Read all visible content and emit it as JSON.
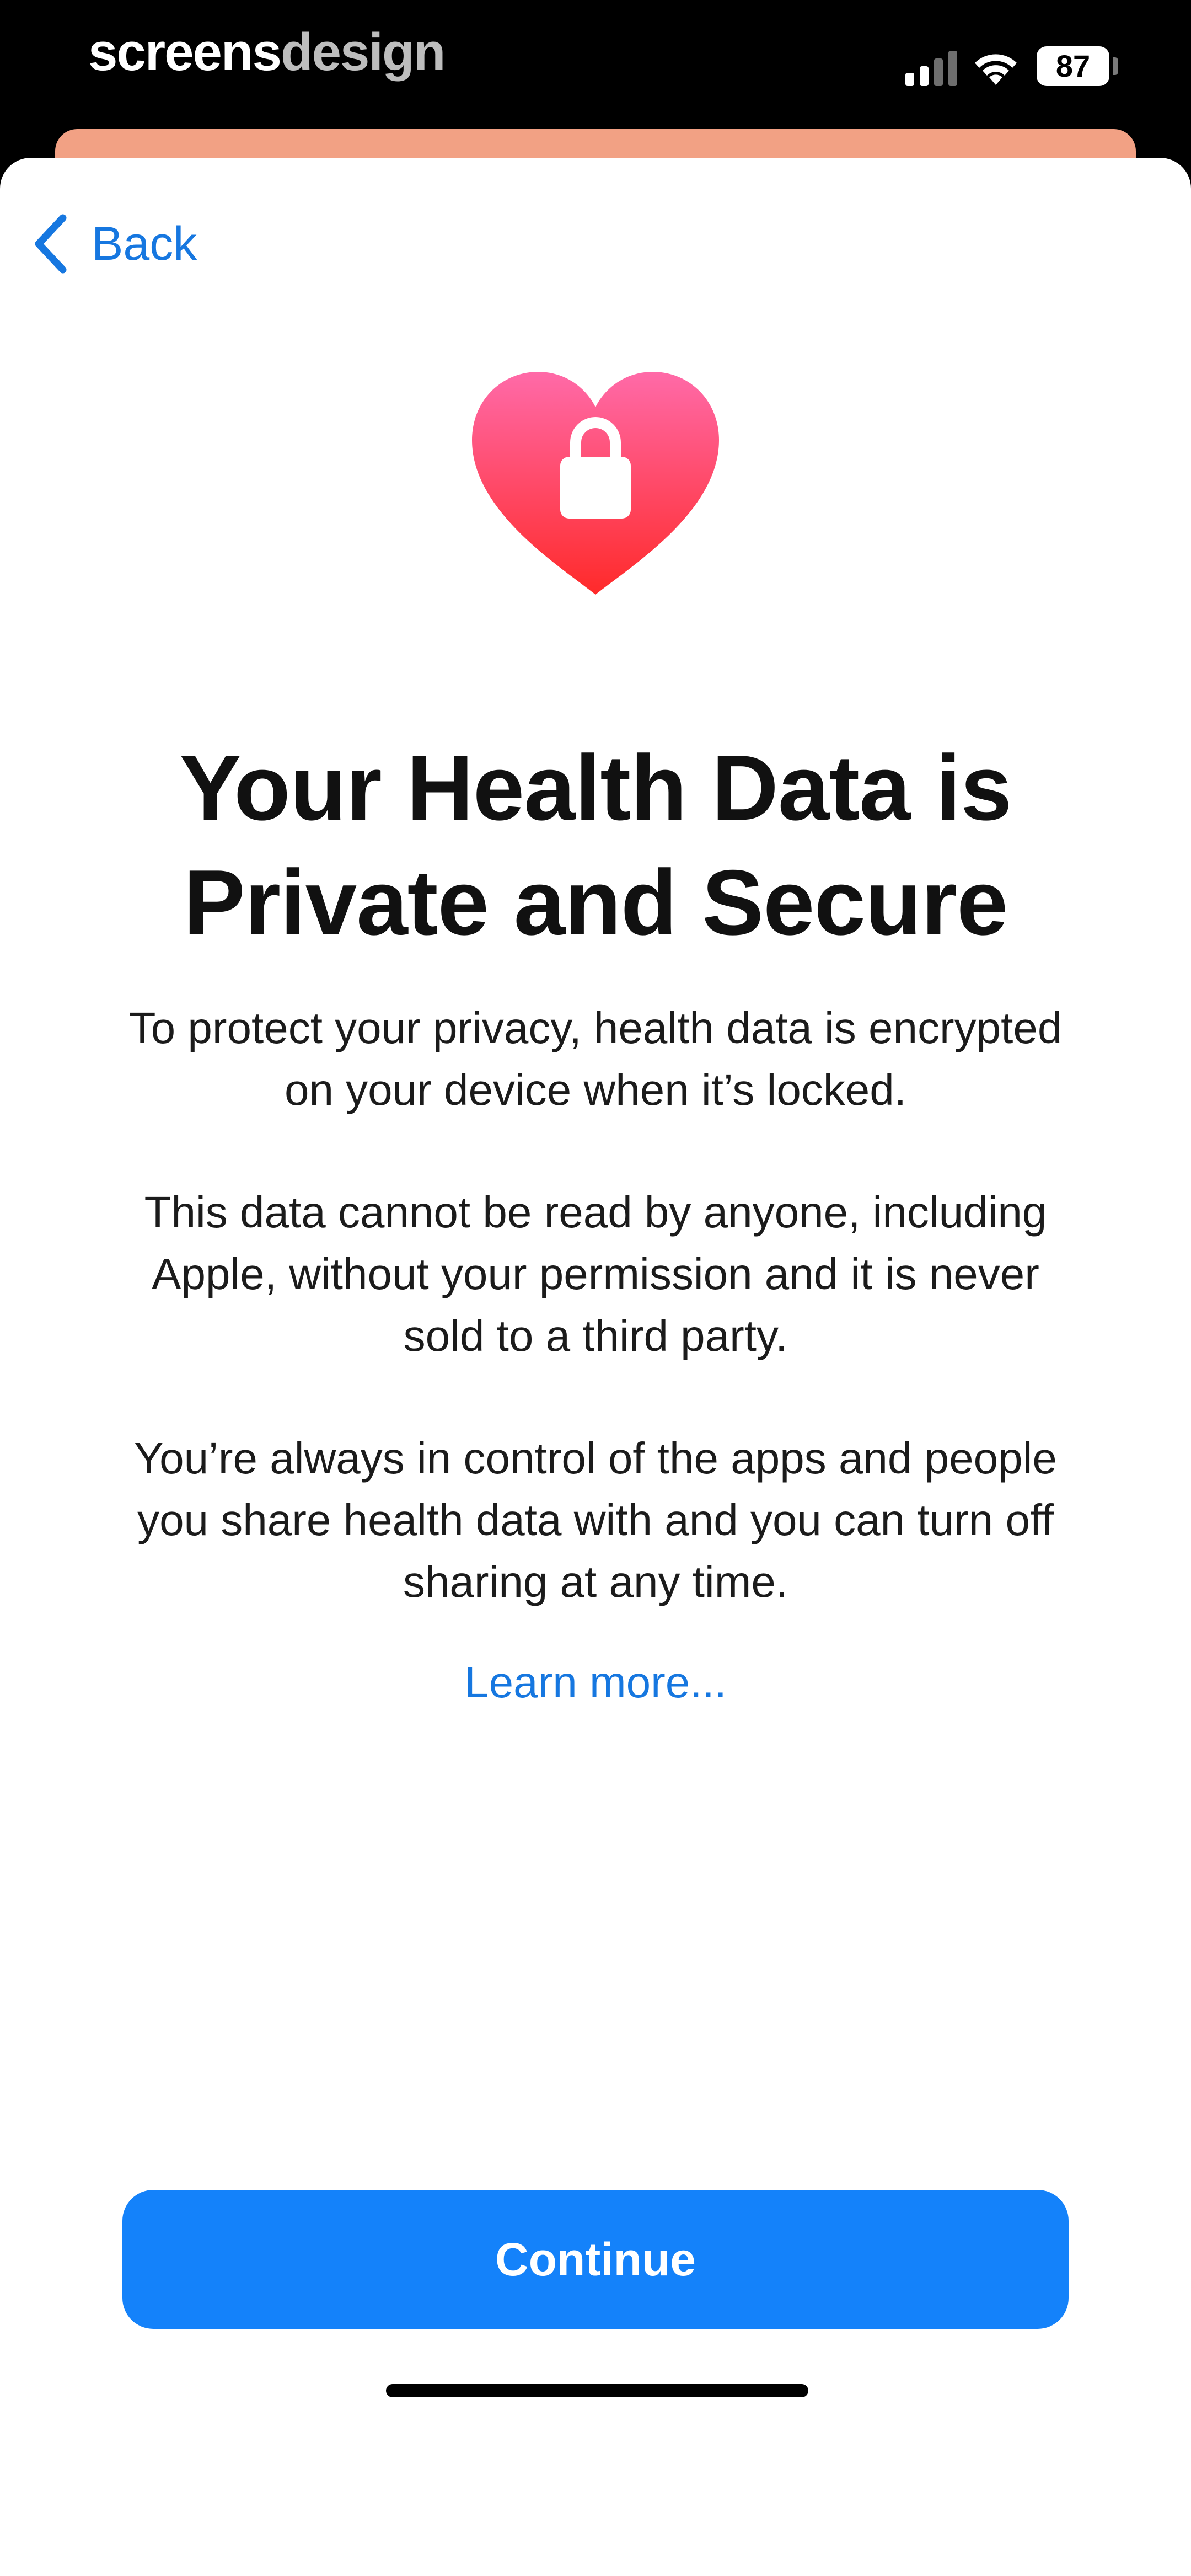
{
  "status_bar": {
    "watermark_part1": "screens",
    "watermark_part2": "design",
    "battery_level": "87",
    "icons": [
      "signal-icon",
      "wifi-icon",
      "battery-icon"
    ]
  },
  "nav": {
    "back_label": "Back",
    "icon": "chevron-left-icon"
  },
  "hero": {
    "icon": "heart-lock-icon",
    "colors": {
      "heart_top": "#ff6aa8",
      "heart_bottom": "#ff2a2a"
    }
  },
  "title": "Your Health Data is Private and Secure",
  "paragraphs": [
    "To protect your privacy, health data is encrypted on your device when it’s locked.",
    "This data cannot be read by anyone, including Apple, without your permission and it is never sold to a third party.",
    "You’re always in control of the apps and people you share health data with and you can turn off sharing at any time."
  ],
  "learn_more": "Learn more...",
  "continue_label": "Continue",
  "colors": {
    "accent": "#1677e0",
    "button": "#1482fa",
    "peek_card": "#f2a184"
  }
}
